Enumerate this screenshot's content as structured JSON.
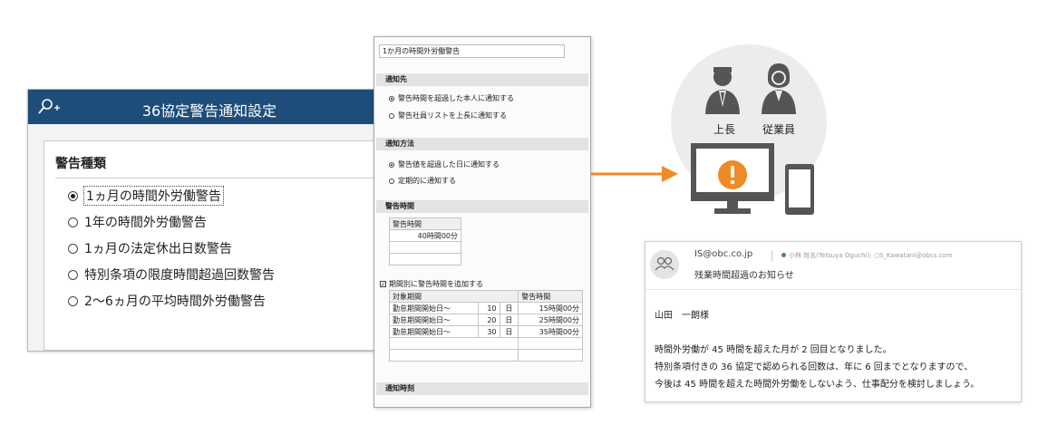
{
  "dialog": {
    "title": "36協定警告通知設定",
    "section_title": "警告種類",
    "options": [
      {
        "label": "1ヵ月の時間外労働警告",
        "selected": true
      },
      {
        "label": "1年の時間外労働警告",
        "selected": false
      },
      {
        "label": "1ヵ月の法定休出日数警告",
        "selected": false
      },
      {
        "label": "特別条項の限度時間超過回数警告",
        "selected": false
      },
      {
        "label": "2～6ヵ月の平均時間外労働警告",
        "selected": false
      }
    ]
  },
  "panel": {
    "name_value": "1か月の時間外労働警告",
    "notify_to": {
      "title": "通知先",
      "options": [
        {
          "label": "警告時間を超過した本人に通知する",
          "selected": true
        },
        {
          "label": "警告社員リストを上長に通知する",
          "selected": false
        }
      ]
    },
    "notify_method": {
      "title": "通知方法",
      "options": [
        {
          "label": "警告値を超過した日に通知する",
          "selected": true
        },
        {
          "label": "定期的に通知する",
          "selected": false
        }
      ]
    },
    "warning_time": {
      "title": "警告時間",
      "header": "警告時間",
      "value": "40時間00分"
    },
    "period_checkbox": {
      "label": "期間別に警告時間を追加する",
      "checked": true
    },
    "period_table": {
      "headers": [
        "対象期間",
        "警告時間"
      ],
      "rows": [
        {
          "label": "勤怠期間開始日～",
          "day": "10",
          "unit": "日",
          "time": "15時間00分"
        },
        {
          "label": "勤怠期間開始日～",
          "day": "20",
          "unit": "日",
          "time": "25時間00分"
        },
        {
          "label": "勤怠期間開始日～",
          "day": "30",
          "unit": "日",
          "time": "35時間00分"
        }
      ]
    },
    "notify_time_title": "通知時刻"
  },
  "illustration": {
    "boss_label": "上長",
    "employee_label": "従業員",
    "alert_color": "#f08a24"
  },
  "email": {
    "from": "IS@obc.co.jp",
    "to": "小林 姓名(Tetsuya Oguchi); ○S_Kawatani@obcs.com",
    "subject": "残業時間超過のお知らせ",
    "greeting": "山田　一朗様",
    "body_lines": [
      "時間外労働が 45 時間を超えた月が 2 回目となりました。",
      "特別条項付きの 36 協定で認められる回数は、年に 6 回までとなりますので、",
      "今後は 45 時間を超えた時間外労働をしないよう、仕事配分を検討しましょう。"
    ]
  },
  "colors": {
    "title_bar": "#1e4d79",
    "arrow": "#f08a24",
    "alert": "#f08a24"
  }
}
